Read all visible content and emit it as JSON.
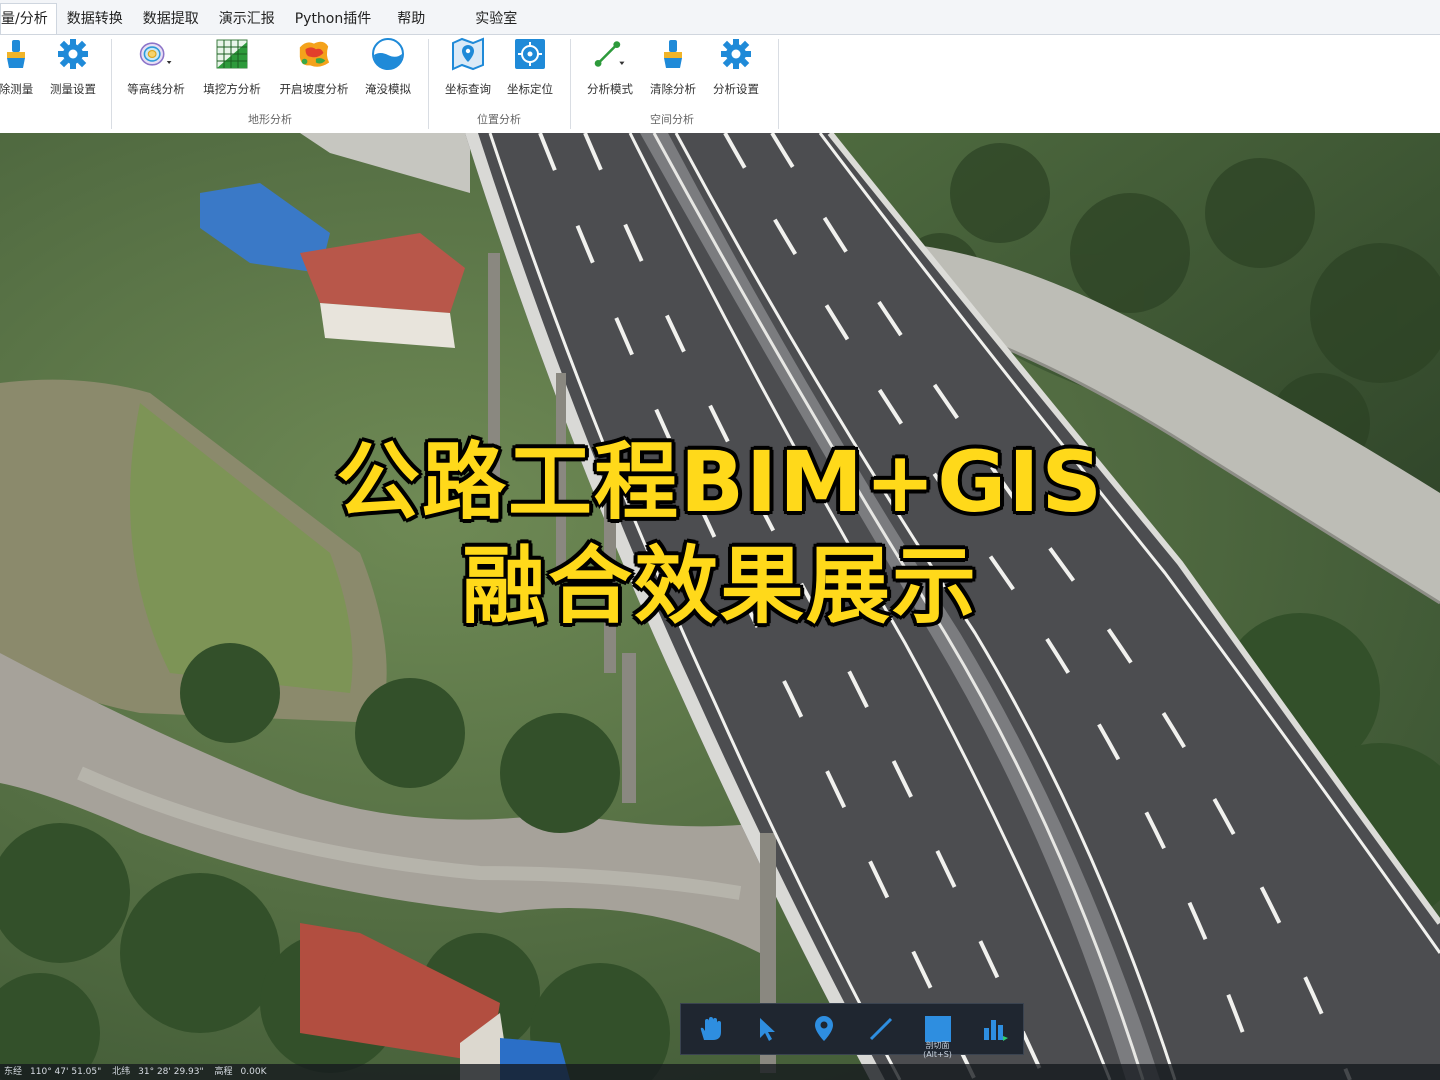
{
  "tabs": [
    "量/分析",
    "数据转换",
    "数据提取",
    "演示汇报",
    "Python插件",
    "帮助",
    "实验室"
  ],
  "active_tab": 0,
  "ribbon": {
    "measure": {
      "clear_label": "除测量",
      "settings_label": "测量设置"
    },
    "terrain": {
      "group_label": "地形分析",
      "contour_label": "等高线分析",
      "cutfill_label": "填挖方分析",
      "slope_label": "开启坡度分析",
      "flood_label": "淹没模拟"
    },
    "location": {
      "group_label": "位置分析",
      "coord_query_label": "坐标查询",
      "coord_locate_label": "坐标定位"
    },
    "spatial": {
      "group_label": "空间分析",
      "mode_label": "分析模式",
      "clear_label": "清除分析",
      "settings_label": "分析设置"
    }
  },
  "overlay": {
    "line1": "公路工程BIM+GIS",
    "line2": "融合效果展示",
    "color": "#ffd91a"
  },
  "navbar": {
    "section_hint": "剖切面\n(Alt+S)"
  },
  "statusbar": {
    "lon_label": "东经",
    "lon": "110°  47'  51.05\"",
    "lat_label": "北纬",
    "lat": "31°  28'  29.93\"",
    "elev_label": "高程",
    "elev": "0.00K"
  },
  "colors": {
    "ribbon_blue": "#1f8ad8",
    "accent_green": "#2d9a3b"
  }
}
